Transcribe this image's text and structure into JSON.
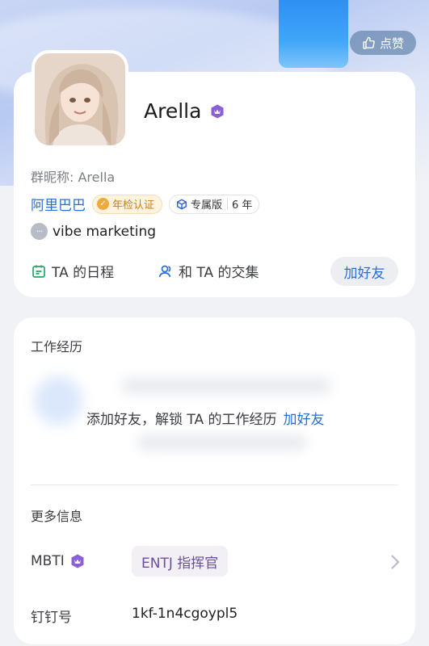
{
  "header": {
    "like_label": "点赞"
  },
  "profile": {
    "name": "Arella",
    "nickname": "群昵称: Arella",
    "organization": "阿里巴巴",
    "annual_badge": "年检认证",
    "edition_badge": "专属版",
    "edition_years": "6 年",
    "status": "vibe marketing",
    "actions": {
      "schedule": "TA 的日程",
      "meet": "和 TA 的交集",
      "add_friend": "加好友"
    }
  },
  "work": {
    "title": "工作经历",
    "unlock_text": "添加好友，解锁 TA 的工作经历",
    "unlock_link": "加好友"
  },
  "more_info": {
    "title": "更多信息",
    "mbti_label": "MBTI",
    "mbti_value": "ENTJ 指挥官",
    "dingtalk_label": "钉钉号",
    "dingtalk_value": "1kf-1n4cgoypl5"
  },
  "colors": {
    "accent": "#2a6fd6",
    "vip": "#8b5fd6",
    "badge_gold": "#f0a93c"
  }
}
